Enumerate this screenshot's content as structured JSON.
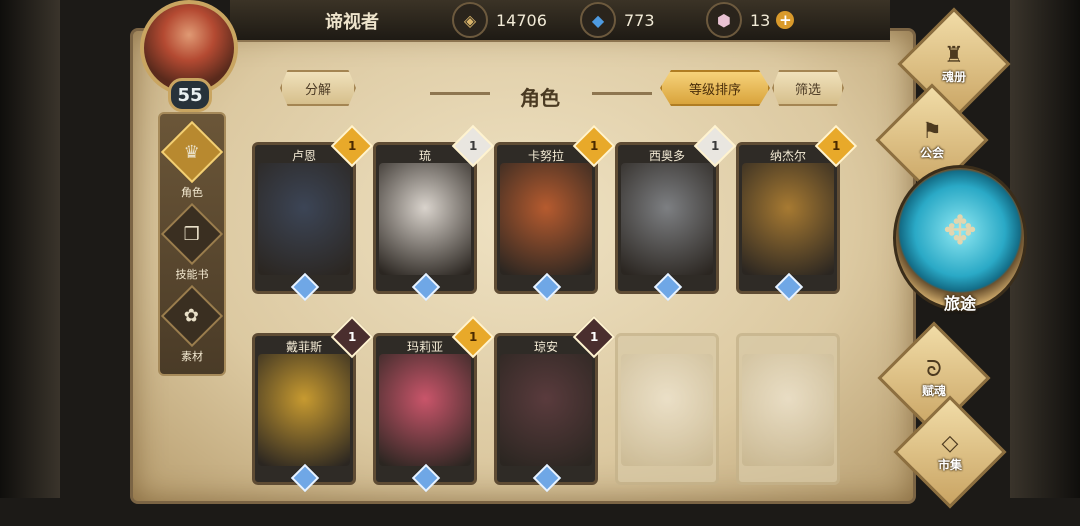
{
  "player": {
    "name": "谛视者",
    "level": "55"
  },
  "resources": [
    {
      "icon": "gold-coin-icon",
      "value": "14706"
    },
    {
      "icon": "blue-crystal-icon",
      "value": "773"
    },
    {
      "icon": "pink-gem-icon",
      "value": "13"
    }
  ],
  "plus": "+",
  "nav": [
    {
      "label": "角色",
      "icon": "character-crest-icon",
      "active": true
    },
    {
      "label": "技能书",
      "icon": "skill-book-icon",
      "active": false
    },
    {
      "label": "素材",
      "icon": "materials-icon",
      "active": false
    }
  ],
  "toolbar": {
    "decompose": "分解",
    "title": "角色",
    "sort": "等级排序",
    "filter": "筛选"
  },
  "cards": [
    {
      "name": "卢恩",
      "stars": "1",
      "rank": "gold",
      "color": "#3c4556"
    },
    {
      "name": "琉",
      "stars": "1",
      "rank": "white",
      "color": "#d9d3cc"
    },
    {
      "name": "卡努拉",
      "stars": "1",
      "rank": "gold",
      "color": "#b65b2f"
    },
    {
      "name": "西奥多",
      "stars": "1",
      "rank": "white",
      "color": "#7d7f82"
    },
    {
      "name": "纳杰尔",
      "stars": "1",
      "rank": "gold",
      "color": "#a77a32"
    },
    {
      "name": "戴菲斯",
      "stars": "1",
      "rank": "dark",
      "color": "#c79a30"
    },
    {
      "name": "玛莉亚",
      "stars": "1",
      "rank": "gold",
      "color": "#c9556a"
    },
    {
      "name": "琼安",
      "stars": "1",
      "rank": "dark",
      "color": "#5a3b3d"
    },
    {
      "name": "",
      "stars": "",
      "rank": "locked",
      "color": "#e3d7bc"
    },
    {
      "name": "",
      "stars": "",
      "rank": "locked",
      "color": "#e3d7bc"
    }
  ],
  "rightnav": {
    "soul": "魂册",
    "guild": "公会",
    "journey": "旅途",
    "talent": "赋魂",
    "market": "市集"
  }
}
